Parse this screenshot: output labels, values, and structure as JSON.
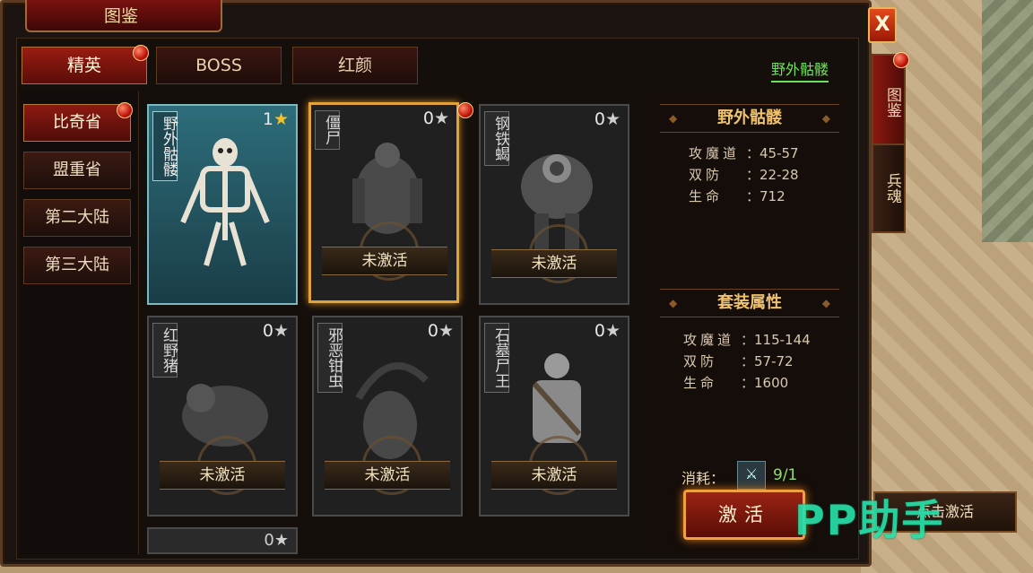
{
  "window": {
    "title": "图鉴",
    "close_label": "X"
  },
  "tabs": [
    {
      "label": "精英",
      "active": true,
      "badge": true
    },
    {
      "label": "BOSS",
      "active": false,
      "badge": false
    },
    {
      "label": "红颜",
      "active": false,
      "badge": false
    }
  ],
  "wild_link": "野外骷髅",
  "provinces": [
    {
      "label": "比奇省",
      "active": true,
      "badge": true
    },
    {
      "label": "盟重省",
      "active": false
    },
    {
      "label": "第二大陆",
      "active": false
    },
    {
      "label": "第三大陆",
      "active": false
    }
  ],
  "cards": [
    {
      "name": "野外骷髅",
      "stars": "1",
      "status": "",
      "style": "teal",
      "badge": false
    },
    {
      "name": "僵尸",
      "stars": "0",
      "status": "未激活",
      "style": "gold",
      "badge": true
    },
    {
      "name": "钢铁蝎",
      "stars": "0",
      "status": "未激活",
      "style": "dark",
      "badge": false
    },
    {
      "name": "红野猪",
      "stars": "0",
      "status": "未激活",
      "style": "dark",
      "badge": false
    },
    {
      "name": "邪恶钳虫",
      "stars": "0",
      "status": "未激活",
      "style": "dark",
      "badge": false
    },
    {
      "name": "石墓尸王",
      "stars": "0",
      "status": "未激活",
      "style": "dark",
      "badge": false
    },
    {
      "name": "",
      "stars": "0",
      "status": "",
      "style": "dark",
      "badge": false
    }
  ],
  "right_panel": {
    "monster_title": "野外骷髅",
    "monster_stats": [
      {
        "label": "攻魔道",
        "value": "45-57"
      },
      {
        "label": "双防",
        "value": "22-28"
      },
      {
        "label": "生命",
        "value": "712"
      }
    ],
    "set_title": "套装属性",
    "set_stats": [
      {
        "label": "攻魔道",
        "value": "115-144"
      },
      {
        "label": "双防",
        "value": "57-72"
      },
      {
        "label": "生命",
        "value": "1600"
      }
    ],
    "consume_label": "消耗：",
    "consume_value": "9/1",
    "activate_label": "激活"
  },
  "side_tabs": [
    {
      "label": "图鉴",
      "active": true,
      "badge": true
    },
    {
      "label": "兵魂",
      "active": false,
      "badge": false
    }
  ],
  "click_activate_label": "点击激活",
  "watermark": "PP助手",
  "colors": {
    "accent_red": "#9a1c12",
    "gold_border": "#e0a23a",
    "green_text": "#6ee05a",
    "watermark": "#27e0a8"
  }
}
